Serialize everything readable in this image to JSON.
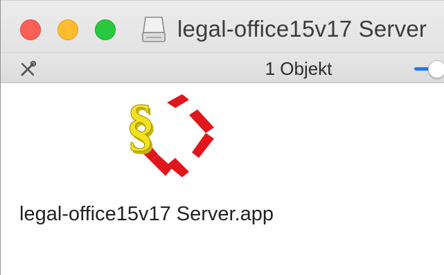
{
  "window": {
    "title": "legal-office15v17 Server"
  },
  "statusbar": {
    "item_count": "1 Objekt",
    "tools_icon": "tools-icon",
    "zoom_level": 1.0
  },
  "items": [
    {
      "label": "legal-office15v17 Server.app",
      "icon": "legal-office-app-icon"
    }
  ],
  "colors": {
    "close": "#fe5f57",
    "minimize": "#febc2e",
    "maximize": "#28c840",
    "accent": "#1a7bff",
    "logo_red": "#e0161b",
    "logo_yellow": "#f4e31c"
  }
}
